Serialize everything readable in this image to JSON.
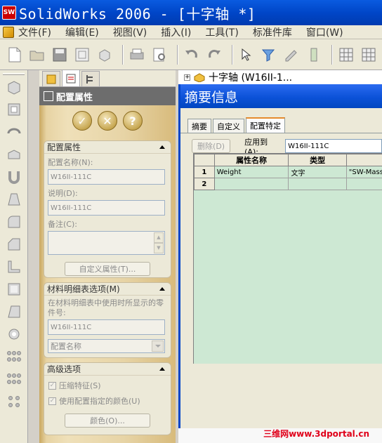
{
  "window": {
    "app_logo": "SW",
    "title": "SolidWorks 2006 - [十字轴 *]"
  },
  "menu": {
    "items": [
      "文件(F)",
      "编辑(E)",
      "视图(V)",
      "插入(I)",
      "工具(T)",
      "标准件库",
      "窗口(W)"
    ]
  },
  "toolbar": {
    "icons": [
      "new-document-icon",
      "open-icon",
      "save-icon",
      "make-drawing-icon",
      "make-assembly-icon",
      "print-icon",
      "print-preview-icon",
      "undo-icon",
      "redo-icon",
      "select-icon",
      "selection-filter-icon",
      "sketch-icon",
      "options-icon",
      "view-grid-icon",
      "view-icon-2"
    ]
  },
  "property_manager": {
    "tabs": [
      "feature-manager-icon",
      "property-manager-icon",
      "configuration-manager-icon"
    ],
    "title": "配置属性",
    "actions": {
      "ok": "✓",
      "cancel": "✕",
      "help": "?"
    },
    "config_group": {
      "title": "配置属性",
      "name_label": "配置名称(N):",
      "name_value": "W16II-111C",
      "desc_label": "说明(D):",
      "desc_value": "W16II-111C",
      "comment_label": "备注(C):",
      "custom_button": "自定义属性(T)..."
    },
    "bom_group": {
      "title": "材料明细表选项(M)",
      "hint": "在材料明细表中使用时所显示的零件号:",
      "part_number": "W16II-111C",
      "select_value": "配置名称"
    },
    "advanced_group": {
      "title": "高级选项",
      "suppress_label": "压缩特征(S)",
      "color_label": "使用配置指定的颜色(U)",
      "color_button": "颜色(O)..."
    }
  },
  "tree": {
    "root_label": "十字轴  (W16II-1..."
  },
  "dialog": {
    "title": "摘要信息",
    "tabs": [
      "摘要",
      "自定义",
      "配置特定"
    ],
    "delete_button": "删除(D)",
    "apply_label": "应用到(A):",
    "apply_value": "W16II-111C",
    "grid": {
      "headers": [
        "属性名称",
        "类型",
        ""
      ],
      "rows": [
        {
          "num": "1",
          "name": "Weight",
          "type": "文字",
          "value": "\"SW-Mass"
        },
        {
          "num": "2",
          "name": "",
          "type": "",
          "value": ""
        }
      ]
    }
  },
  "watermark": "三维网www.3dportal.cn"
}
